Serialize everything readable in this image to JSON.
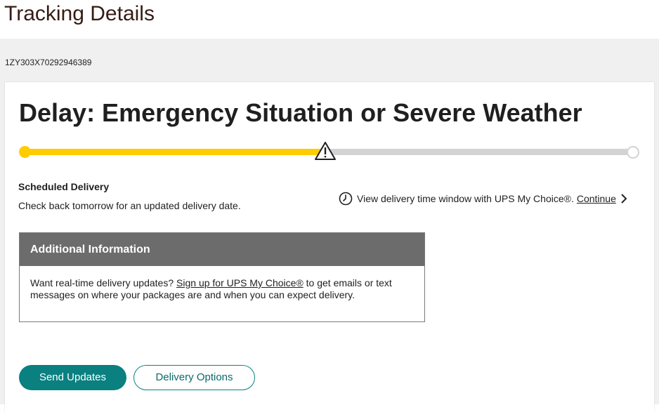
{
  "header": {
    "title": "Tracking Details"
  },
  "tracking": {
    "number": "1ZY303X70292946389"
  },
  "status": {
    "heading": "Delay: Emergency Situation or Severe Weather",
    "progress_fraction": 0.5,
    "colors": {
      "fill": "#ffcc00",
      "track": "#d3d3d3"
    }
  },
  "delivery": {
    "label": "Scheduled Delivery",
    "message": "Check back tomorrow for an updated delivery date."
  },
  "my_choice": {
    "text": "View delivery time window with UPS My Choice®.",
    "link": "Continue",
    "icon": "clock-icon",
    "link_icon": "chevron-right-icon"
  },
  "additional_info": {
    "title": "Additional Information",
    "text_before": "Want real-time delivery updates?",
    "link": "Sign up for UPS My Choice®",
    "text_after": "to get emails or text messages on where your packages are and when you can expect delivery."
  },
  "actions": {
    "send_updates": "Send Updates",
    "delivery_options": "Delivery Options",
    "accent_color": "#0a8080"
  }
}
